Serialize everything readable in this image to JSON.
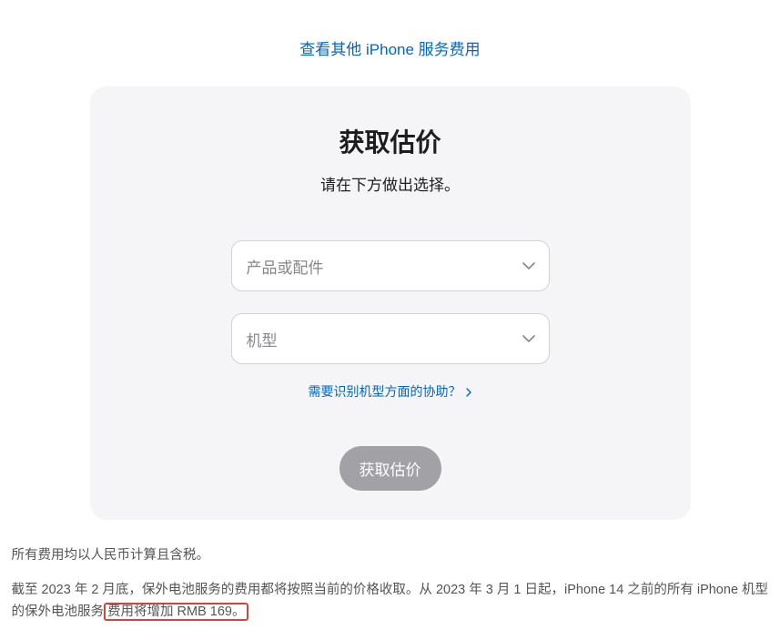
{
  "topLink": {
    "label": "查看其他 iPhone 服务费用"
  },
  "card": {
    "title": "获取估价",
    "subtitle": "请在下方做出选择。",
    "select1": {
      "placeholder": "产品或配件"
    },
    "select2": {
      "placeholder": "机型"
    },
    "helpLink": {
      "label": "需要识别机型方面的协助？"
    },
    "submitLabel": "获取估价"
  },
  "footnote1": "所有费用均以人民币计算且含税。",
  "footnote2_prefix": "截至 2023 年 2 月底，保外电池服务的费用都将按照当前的价格收取。从 2023 年 3 月 1 日起，iPhone 14 之前的所有 iPhone 机型的保外电池服务",
  "footnote2_highlight": "费用将增加 RMB 169。"
}
